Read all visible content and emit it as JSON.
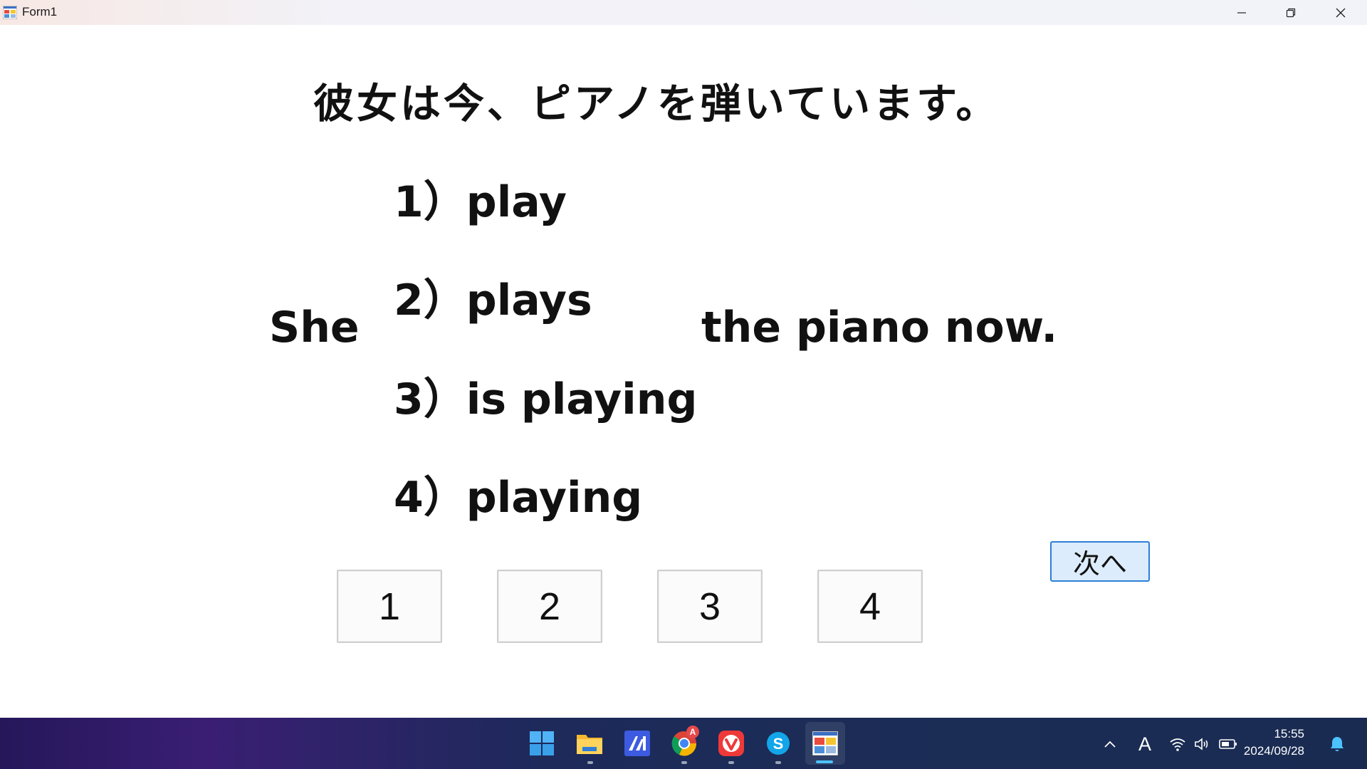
{
  "window": {
    "title": "Form1"
  },
  "question": {
    "japanese": "彼女は今、ピアノを弾いています。",
    "subject": "She",
    "rest": "the piano now."
  },
  "choices": [
    {
      "label": "1）play"
    },
    {
      "label": "2）plays"
    },
    {
      "label": "3）is playing"
    },
    {
      "label": "4）playing"
    }
  ],
  "answer_buttons": [
    "1",
    "2",
    "3",
    "4"
  ],
  "next_button": "次へ",
  "taskbar": {
    "apps": [
      "windows-start",
      "file-explorer",
      "app-m",
      "chrome",
      "vivaldi",
      "skype",
      "form-app"
    ],
    "chrome_badge": "A",
    "ime_indicator": "A",
    "time": "15:55",
    "date": "2024/09/28"
  },
  "colors": {
    "next_button_bg": "#dcecfc",
    "next_button_border": "#2c7fd6",
    "taskbar_accent": "#4cc2ff"
  }
}
